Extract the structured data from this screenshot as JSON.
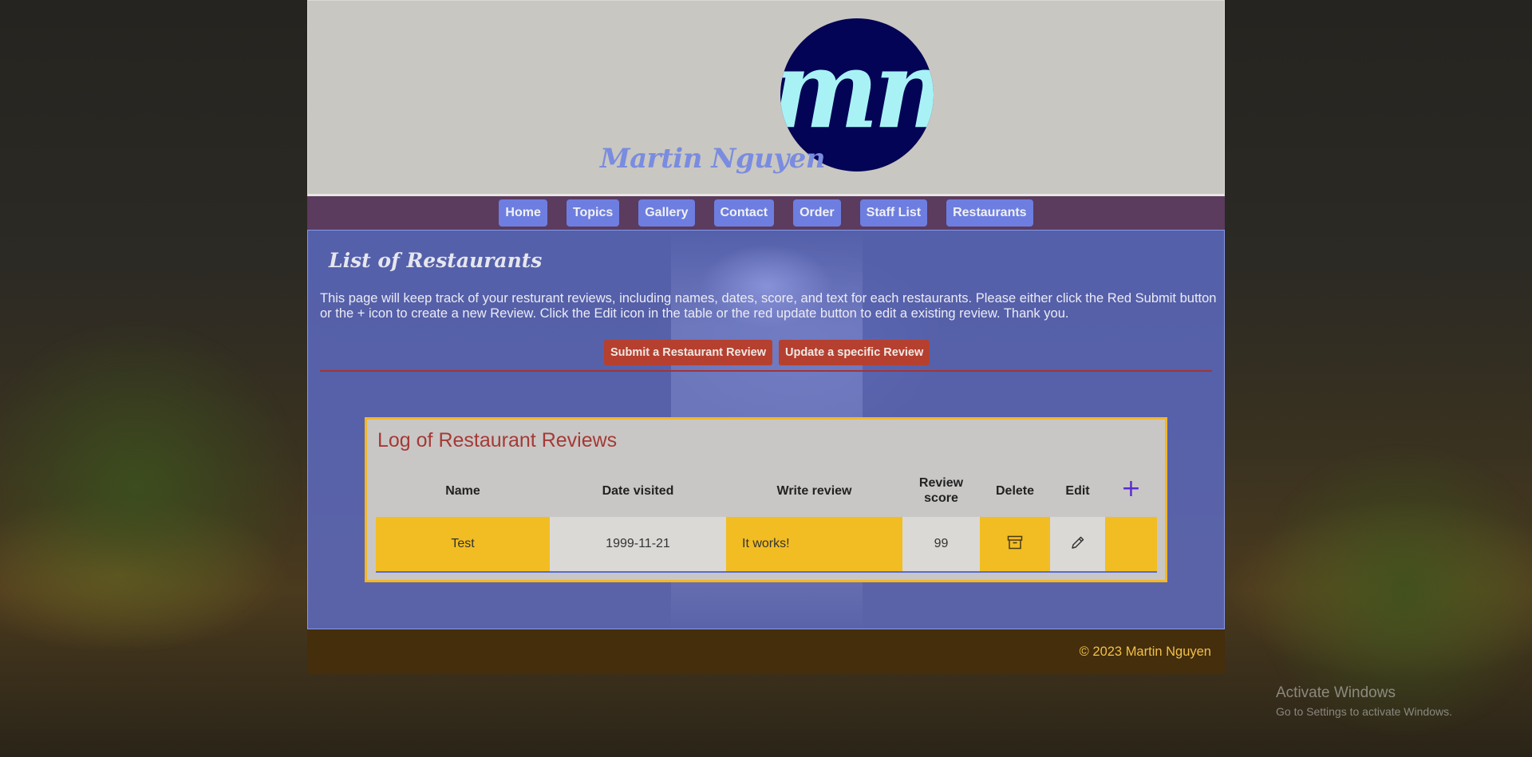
{
  "header": {
    "logo_text": "mn",
    "site_name": "Martin Nguyen"
  },
  "nav": {
    "items": [
      "Home",
      "Topics",
      "Gallery",
      "Contact",
      "Order",
      "Staff List",
      "Restaurants"
    ]
  },
  "main": {
    "title": "List of Restaurants",
    "intro": "This page will keep track of your resturant reviews, including names, dates, score, and text for each restaurants. Please either click the Red Submit button or the + icon to create a new Review. Click the Edit icon in the table or the red update button to edit a existing review. Thank you.",
    "submit_button": "Submit a Restaurant Review",
    "update_button": "Update a specific Review"
  },
  "log": {
    "title": "Log of Restaurant Reviews",
    "columns": [
      "Name",
      "Date visited",
      "Write review",
      "Review score",
      "Delete",
      "Edit"
    ],
    "add_icon": "plus-icon",
    "rows": [
      {
        "name": "Test",
        "date": "1999-11-21",
        "review": "It works!",
        "score": "99",
        "delete_icon": "archive-icon",
        "edit_icon": "pencil-icon"
      }
    ]
  },
  "footer": {
    "copyright": "© 2023 Martin Nguyen"
  },
  "os_overlay": {
    "activate_title": "Activate Windows",
    "activate_sub": "Go to Settings to activate Windows."
  },
  "colors": {
    "nav_button": "#6d7ee0",
    "red_button": "#b5402f",
    "table_highlight": "#f2bd22",
    "footer_text": "#f2c04a"
  }
}
